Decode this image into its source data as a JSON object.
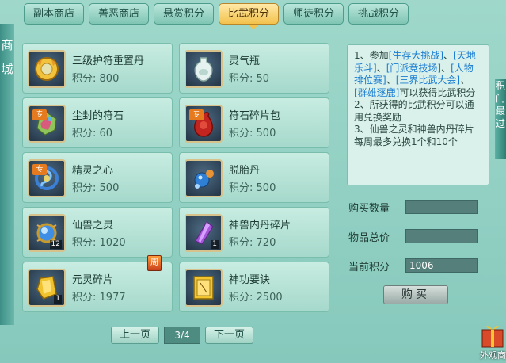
{
  "tabs": [
    {
      "label": "副本商店",
      "active": false
    },
    {
      "label": "善恶商店",
      "active": false
    },
    {
      "label": "悬赏积分",
      "active": false
    },
    {
      "label": "比武积分",
      "active": true
    },
    {
      "label": "师徒积分",
      "active": false
    },
    {
      "label": "挑战积分",
      "active": false
    }
  ],
  "left_strip": {
    "chars": "商\n城"
  },
  "price_prefix": "积分:",
  "items": [
    {
      "name": "三级护符重置丹",
      "price": "800",
      "icon": "gold-coin-icon",
      "tag": "",
      "count": ""
    },
    {
      "name": "灵气瓶",
      "price": "50",
      "icon": "vase-icon",
      "tag": "",
      "count": ""
    },
    {
      "name": "尘封的符石",
      "price": "60",
      "icon": "gem-stone-icon",
      "tag": "专",
      "count": ""
    },
    {
      "name": "符石碎片包",
      "price": "500",
      "icon": "red-bag-icon",
      "tag": "专",
      "count": ""
    },
    {
      "name": "精灵之心",
      "price": "500",
      "icon": "dragon-heart-icon",
      "tag": "专",
      "count": ""
    },
    {
      "name": "脱胎丹",
      "price": "500",
      "icon": "blue-pill-icon",
      "tag": "",
      "count": ""
    },
    {
      "name": "仙兽之灵",
      "price": "1020",
      "icon": "blue-orb-icon",
      "tag": "",
      "count": "12"
    },
    {
      "name": "神兽内丹碎片",
      "price": "720",
      "icon": "purple-crystal-icon",
      "tag": "",
      "count": "1"
    },
    {
      "name": "元灵碎片",
      "price": "1977",
      "icon": "gold-shard-icon",
      "tag": "",
      "count": "1"
    },
    {
      "name": "神功要诀",
      "price": "2500",
      "icon": "yellow-book-icon",
      "tag": "",
      "count": ""
    }
  ],
  "week_badge": "周",
  "pager": {
    "prev": "上一页",
    "page": "3/4",
    "next": "下一页"
  },
  "info_lines": [
    "1、参加[生存大挑战]、[天地乐斗]、[门派竞技场]、[人物排位赛]、[三界比武大会]、[群雄逐鹿]可以获得比武积分",
    "2、所获得的比武积分可以通用兑换奖励",
    "3、仙兽之灵和神兽内丹碎片每周最多兑换1个和10个"
  ],
  "form": {
    "qty_label": "购买数量",
    "qty_value": "",
    "total_label": "物品总价",
    "total_value": "",
    "points_label": "当前积分",
    "points_value": "1006"
  },
  "buy_label": "购买",
  "corner_label": "外观商",
  "right_strip": "积\n门\n最\n过"
}
